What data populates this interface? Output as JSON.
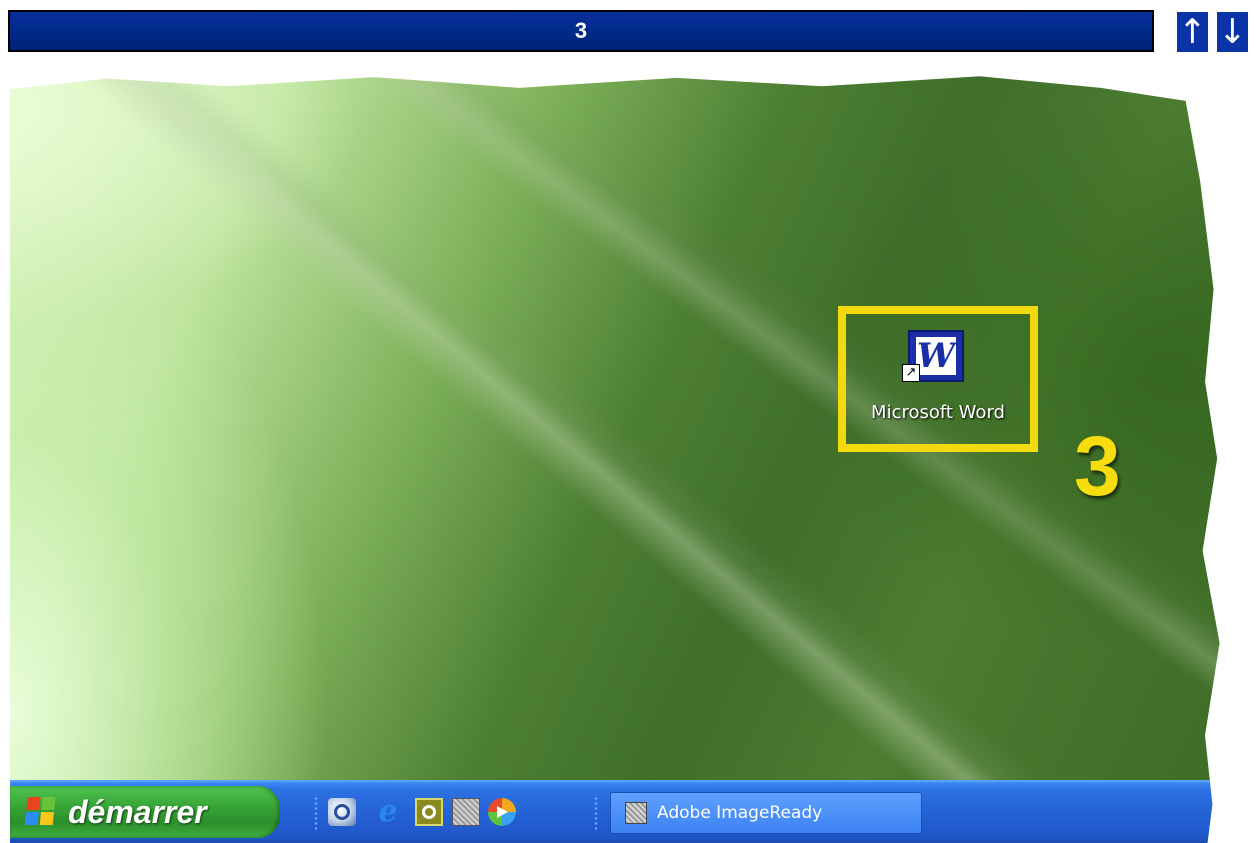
{
  "step_bar": {
    "step_number": "3"
  },
  "navigation": {
    "up_glyph": "↑",
    "down_glyph": "↓"
  },
  "desktop": {
    "icon": {
      "label": "Microsoft Word",
      "icon_name": "microsoft-word-icon",
      "glyph": "W",
      "shortcut_glyph": "↗",
      "highlight_color": "#f5d90f"
    },
    "annotation_number": "3"
  },
  "taskbar": {
    "start_label": "démarrer",
    "quick_launch": [
      {
        "icon_name": "show-desktop-icon"
      },
      {
        "icon_name": "internet-explorer-icon",
        "glyph": "e"
      },
      {
        "icon_name": "app-icon"
      },
      {
        "icon_name": "imageready-icon"
      },
      {
        "icon_name": "media-player-icon"
      }
    ],
    "tasks": [
      {
        "label": "Adobe ImageReady",
        "icon_name": "imageready-icon"
      }
    ]
  },
  "colors": {
    "step_bar_bg": "#002a8a",
    "taskbar_blue": "#2462d6",
    "start_green": "#37a537",
    "annotation_yellow": "#f7dd10"
  }
}
